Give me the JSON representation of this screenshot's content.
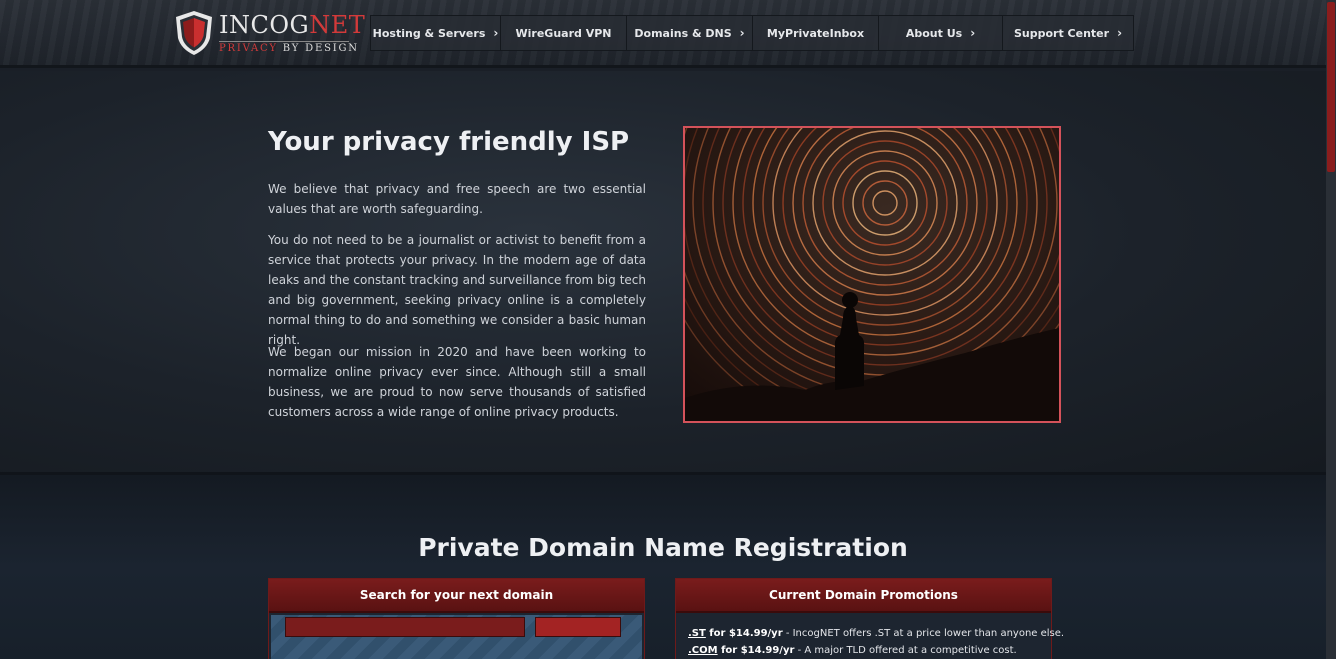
{
  "header": {
    "brand_main": "INCOG",
    "brand_accent": "NET",
    "tagline_accent": "PRIVACY",
    "tagline_rest": " BY DESIGN",
    "nav": [
      {
        "label": "Hosting & Servers",
        "has_submenu": true
      },
      {
        "label": "WireGuard VPN",
        "has_submenu": false
      },
      {
        "label": "Domains & DNS",
        "has_submenu": true
      },
      {
        "label": "MyPrivateInbox",
        "has_submenu": false
      },
      {
        "label": "About Us",
        "has_submenu": true
      },
      {
        "label": "Support Center",
        "has_submenu": true
      }
    ]
  },
  "hero": {
    "title": "Your privacy friendly ISP",
    "paragraphs": [
      "We believe that privacy and free speech are two essential values that are worth safeguarding.",
      "You do not need to be a journalist or activist to benefit from a service that protects your privacy. In the modern age of data leaks and the constant tracking and surveillance from big tech and big government, seeking privacy online is a completely normal thing to do and something we consider a basic human right.",
      "We began our mission in 2020 and have been working to normalize online privacy ever since. Although still a small business, we are proud to now serve thousands of satisfied customers across a wide range of online privacy products."
    ]
  },
  "domains": {
    "title": "Private Domain Name Registration",
    "search_panel": {
      "title": "Search for your next domain"
    },
    "promo_panel": {
      "title": "Current Domain Promotions",
      "promos": [
        {
          "tld": ".ST",
          "price": " for $14.99/yr",
          "desc": " - IncogNET offers .ST at a price lower than anyone else."
        },
        {
          "tld": ".COM",
          "price": " for $14.99/yr",
          "desc": " - A major TLD offered at a competitive cost."
        }
      ]
    }
  },
  "colors": {
    "accent_red": "#d23a3a",
    "panel_red": "#7a1c1c",
    "background": "#1a1f27"
  }
}
